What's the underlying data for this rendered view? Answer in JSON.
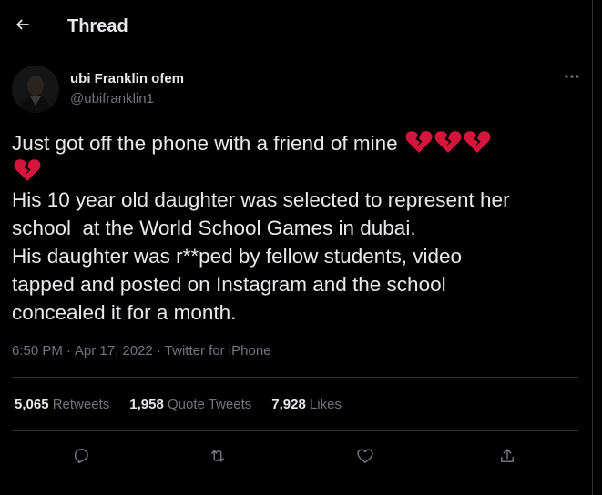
{
  "header": {
    "back_icon": "arrow-left-icon",
    "title": "Thread"
  },
  "tweet": {
    "author": {
      "name": "ubi Franklin ofem",
      "handle": "@ubifranklin1",
      "avatar_icon": "profile-photo"
    },
    "more_icon": "more-horizontal-icon",
    "text_lines": [
      "Just got off the phone with a friend of mine",
      "His 10 year old daughter was selected to represent her",
      "school  at the World School Games in dubai.",
      "His daughter was r**ped by fellow students, video",
      "tapped and posted on Instagram and the school",
      "concealed it for a month."
    ],
    "emoji": "broken-heart",
    "emoji_count": 4,
    "time": "6:50 PM",
    "date": "Apr 17, 2022",
    "separator": "·",
    "source": "Twitter for iPhone",
    "stats": {
      "retweets_count": "5,065",
      "retweets_label": "Retweets",
      "quotes_count": "1,958",
      "quotes_label": "Quote Tweets",
      "likes_count": "7,928",
      "likes_label": "Likes"
    },
    "actions": {
      "reply_icon": "reply-icon",
      "retweet_icon": "retweet-icon",
      "like_icon": "heart-outline-icon",
      "share_icon": "share-icon"
    }
  },
  "colors": {
    "background": "#000000",
    "text_primary": "#e7e9ea",
    "text_secondary": "#71767b",
    "divider": "#2f3336",
    "broken_heart": "#d4163c"
  }
}
